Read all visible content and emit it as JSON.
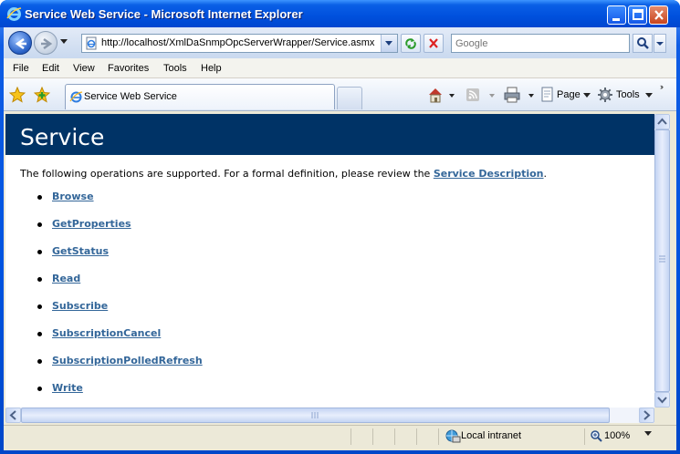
{
  "window": {
    "title": "Service Web Service - Microsoft Internet Explorer"
  },
  "address_bar": {
    "url": "http://localhost/XmlDaSnmpOpcServerWrapper/Service.asmx"
  },
  "search": {
    "placeholder": "Google"
  },
  "menu": {
    "items": [
      "File",
      "Edit",
      "View",
      "Favorites",
      "Tools",
      "Help"
    ]
  },
  "tabs": [
    {
      "label": "Service Web Service",
      "icon": "ie-page-icon"
    }
  ],
  "command_bar": {
    "page_label": "Page",
    "tools_label": "Tools"
  },
  "page": {
    "heading": "Service",
    "intro_text": "The following operations are supported. For a formal definition, please review the ",
    "intro_link": "Service Description",
    "intro_end": ".",
    "operations": [
      "Browse",
      "GetProperties",
      "GetStatus",
      "Read",
      "Subscribe",
      "SubscriptionCancel",
      "SubscriptionPolledRefresh",
      "Write"
    ]
  },
  "status_bar": {
    "zone": "Local intranet",
    "zoom": "100%"
  },
  "colors": {
    "heading_bg": "#003366",
    "link": "#336699",
    "titlebar": "#0050dd"
  }
}
